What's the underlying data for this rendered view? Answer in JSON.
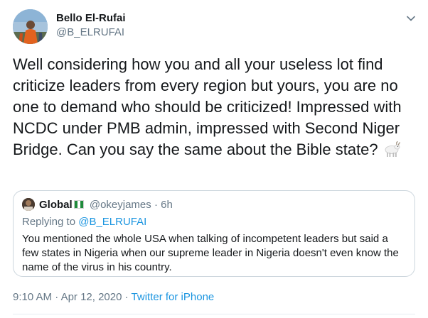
{
  "author": {
    "name": "Bello El-Rufai",
    "handle": "@B_ELRUFAI"
  },
  "menu_icon": "chevron-down-icon",
  "tweet": {
    "text": "Well considering how you and all your useless lot find criticize leaders from every region but yours, you are no one to demand who should be criticized! Impressed with NCDC under PMB admin, impressed with Second Niger Bridge. Can you say the same about the Bible state?",
    "emoji": "goat-emoji"
  },
  "quote": {
    "name": "Global",
    "flag": "nigeria-flag-emoji",
    "handle": "@okeyjames",
    "separator": "·",
    "time": "6h",
    "replying_prefix": "Replying to",
    "replying_to": "@B_ELRUFAI",
    "text": "You mentioned the whole USA when talking of incompetent leaders but said a few states in Nigeria when our supreme leader in Nigeria doesn't even know the name of the virus in his country."
  },
  "meta": {
    "time": "9:10 AM",
    "separator1": "·",
    "date": "Apr 12, 2020",
    "separator2": "·",
    "source": "Twitter for iPhone"
  },
  "colors": {
    "text": "#14171a",
    "secondary": "#657786",
    "link": "#1b95e0",
    "border": "#ccd6dd"
  }
}
